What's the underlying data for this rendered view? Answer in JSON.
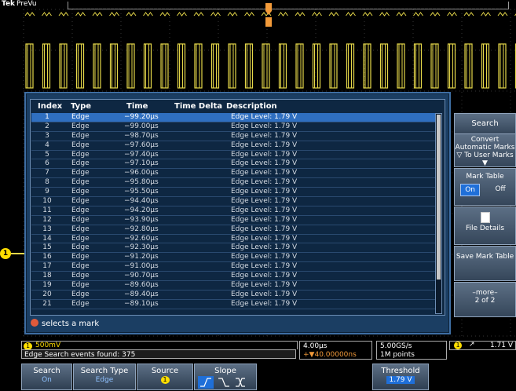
{
  "header": {
    "brand": "Tek",
    "mode": "PreVu"
  },
  "channel_marker": "1",
  "table": {
    "columns": [
      "Index",
      "Type",
      "Time",
      "Time Delta",
      "Description"
    ],
    "rows": [
      {
        "index": "1",
        "type": "Edge",
        "time": "−99.20μs",
        "desc": "Edge Level: 1.79 V"
      },
      {
        "index": "2",
        "type": "Edge",
        "time": "−99.00μs",
        "desc": "Edge Level: 1.79 V"
      },
      {
        "index": "3",
        "type": "Edge",
        "time": "−98.70μs",
        "desc": "Edge Level: 1.79 V"
      },
      {
        "index": "4",
        "type": "Edge",
        "time": "−97.60μs",
        "desc": "Edge Level: 1.79 V"
      },
      {
        "index": "5",
        "type": "Edge",
        "time": "−97.40μs",
        "desc": "Edge Level: 1.79 V"
      },
      {
        "index": "6",
        "type": "Edge",
        "time": "−97.10μs",
        "desc": "Edge Level: 1.79 V"
      },
      {
        "index": "7",
        "type": "Edge",
        "time": "−96.00μs",
        "desc": "Edge Level: 1.79 V"
      },
      {
        "index": "8",
        "type": "Edge",
        "time": "−95.80μs",
        "desc": "Edge Level: 1.79 V"
      },
      {
        "index": "9",
        "type": "Edge",
        "time": "−95.50μs",
        "desc": "Edge Level: 1.79 V"
      },
      {
        "index": "10",
        "type": "Edge",
        "time": "−94.40μs",
        "desc": "Edge Level: 1.79 V"
      },
      {
        "index": "11",
        "type": "Edge",
        "time": "−94.20μs",
        "desc": "Edge Level: 1.79 V"
      },
      {
        "index": "12",
        "type": "Edge",
        "time": "−93.90μs",
        "desc": "Edge Level: 1.79 V"
      },
      {
        "index": "13",
        "type": "Edge",
        "time": "−92.80μs",
        "desc": "Edge Level: 1.79 V"
      },
      {
        "index": "14",
        "type": "Edge",
        "time": "−92.60μs",
        "desc": "Edge Level: 1.79 V"
      },
      {
        "index": "15",
        "type": "Edge",
        "time": "−92.30μs",
        "desc": "Edge Level: 1.79 V"
      },
      {
        "index": "16",
        "type": "Edge",
        "time": "−91.20μs",
        "desc": "Edge Level: 1.79 V"
      },
      {
        "index": "17",
        "type": "Edge",
        "time": "−91.00μs",
        "desc": "Edge Level: 1.79 V"
      },
      {
        "index": "18",
        "type": "Edge",
        "time": "−90.70μs",
        "desc": "Edge Level: 1.79 V"
      },
      {
        "index": "19",
        "type": "Edge",
        "time": "−89.60μs",
        "desc": "Edge Level: 1.79 V"
      },
      {
        "index": "20",
        "type": "Edge",
        "time": "−89.40μs",
        "desc": "Edge Level: 1.79 V"
      },
      {
        "index": "21",
        "type": "Edge",
        "time": "−89.10μs",
        "desc": "Edge Level: 1.79 V"
      }
    ],
    "hint": "selects a mark"
  },
  "side_menu": {
    "title": "Search",
    "convert": "Convert Automatic Marks ▽ To User Marks ▼",
    "mark_table_label": "Mark Table",
    "on": "On",
    "off": "Off",
    "file_details": "File Details",
    "save": "Save Mark Table",
    "more": "–more–",
    "more_page": "2 of 2"
  },
  "status": {
    "ch1_badge": "1",
    "ch1_scale": "500mV",
    "found": "Edge Search events found: 375",
    "horiz_scale": "4.00μs",
    "horiz_pos": "+▼40.00000ns",
    "sample_rate": "5.00GS/s",
    "record": "1M points",
    "trig_ch": "1",
    "trig_slope": "↗",
    "trig_level": "1.71 V"
  },
  "bottom_menu": {
    "search": {
      "label": "Search",
      "value": "On"
    },
    "search_type": {
      "label": "Search Type",
      "value": "Edge"
    },
    "source": {
      "label": "Source",
      "value": "1"
    },
    "slope": {
      "label": "Slope"
    },
    "threshold": {
      "label": "Threshold",
      "value": "1.79 V"
    }
  },
  "colors": {
    "waveform": "#e6d84a",
    "dialog": "#1b3e63",
    "selected_row": "#2f6fc0",
    "accent": "#1f6fd8"
  }
}
